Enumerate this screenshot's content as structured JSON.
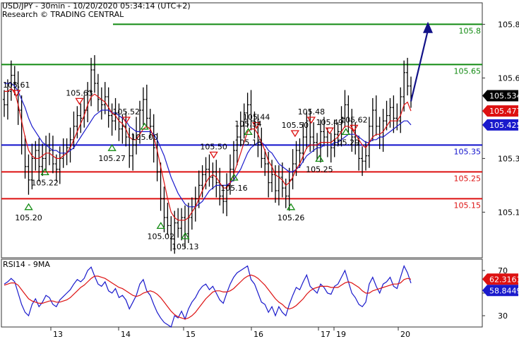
{
  "header": {
    "line1": "USD/JPY - 30min - 10/20/2020 05:34:14 (UTC+2)",
    "line2": "Research © TRADING CENTRAL"
  },
  "colors": {
    "resistance": "#118a11",
    "pivot": "#1010cc",
    "support": "#dd1111",
    "price": "#000000",
    "ma_fast": "#dd1111",
    "ma_slow": "#1a1acc",
    "arrow": "#121288",
    "panel_border": "#333333",
    "last_price_box": "#000000",
    "red_box": "#dd1111",
    "blue_box": "#1a1acc",
    "rsi_fast": "#1a1acc",
    "rsi_slow": "#dd1111"
  },
  "chart_data": [
    {
      "type": "candlestick",
      "title": "USD/JPY - 30min",
      "ylim": [
        104.93,
        105.88
      ],
      "x_labels": [
        "13",
        "14",
        "15",
        "16",
        "17",
        "19",
        "20"
      ],
      "y_ticks": [
        "105.8",
        "105.6",
        "105.3",
        "105.1"
      ],
      "levels": [
        {
          "name": "resistance-2",
          "value": 105.8,
          "label": "105.8",
          "color": "#118a11"
        },
        {
          "name": "resistance-1",
          "value": 105.65,
          "label": "105.65",
          "color": "#118a11"
        },
        {
          "name": "pivot",
          "value": 105.35,
          "label": "105.35",
          "color": "#1010cc"
        },
        {
          "name": "support-1",
          "value": 105.25,
          "label": "105.25",
          "color": "#dd1111"
        },
        {
          "name": "support-2",
          "value": 105.15,
          "label": "105.15",
          "color": "#dd1111"
        }
      ],
      "price_boxes": [
        {
          "name": "last-price",
          "value": 105.534,
          "label": "105.534"
        },
        {
          "name": "ma-fast-value",
          "value": 105.477,
          "label": "105.477"
        },
        {
          "name": "ma-slow-value",
          "value": 105.425,
          "label": "105.425"
        }
      ],
      "swing_highs": [
        {
          "x": 0.03,
          "label": "105.61"
        },
        {
          "x": 0.185,
          "label": "105.63"
        },
        {
          "x": 0.3,
          "label": "105.52"
        },
        {
          "x": 0.515,
          "label": "105.50"
        },
        {
          "x": 0.62,
          "label": "105.44"
        },
        {
          "x": 0.715,
          "label": "105.50"
        },
        {
          "x": 0.755,
          "label": "105.48"
        },
        {
          "x": 0.8,
          "label": "105.49"
        },
        {
          "x": 0.86,
          "label": "105.62"
        }
      ],
      "swing_lows": [
        {
          "x": 0.06,
          "label": "105.20"
        },
        {
          "x": 0.1,
          "label": "105.22"
        },
        {
          "x": 0.265,
          "label": "105.27"
        },
        {
          "x": 0.345,
          "label": "105.00"
        },
        {
          "x": 0.385,
          "label": "105.02"
        },
        {
          "x": 0.445,
          "label": "105.13"
        },
        {
          "x": 0.565,
          "label": "105.16"
        },
        {
          "x": 0.6,
          "label": "105.16"
        },
        {
          "x": 0.705,
          "label": "105.26"
        },
        {
          "x": 0.775,
          "label": "105.25"
        },
        {
          "x": 0.84,
          "label": "105.29"
        }
      ],
      "inline_labels": [
        {
          "x": 0.565,
          "label": "105.34"
        }
      ],
      "projected_target": 105.82,
      "close": [
        105.5,
        105.55,
        105.61,
        105.58,
        105.48,
        105.35,
        105.27,
        105.22,
        105.3,
        105.33,
        105.27,
        105.3,
        105.35,
        105.33,
        105.28,
        105.26,
        105.3,
        105.32,
        105.34,
        105.37,
        105.42,
        105.46,
        105.45,
        105.48,
        105.55,
        105.63,
        105.58,
        105.52,
        105.5,
        105.53,
        105.46,
        105.44,
        105.47,
        105.41,
        105.42,
        105.38,
        105.31,
        105.35,
        105.4,
        105.48,
        105.52,
        105.45,
        105.42,
        105.34,
        105.25,
        105.15,
        105.08,
        105.05,
        105.0,
        105.06,
        105.04,
        105.08,
        105.02,
        105.08,
        105.12,
        105.15,
        105.2,
        105.24,
        105.26,
        105.23,
        105.25,
        105.21,
        105.16,
        105.14,
        105.2,
        105.26,
        105.33,
        105.38,
        105.42,
        105.47,
        105.5,
        105.44,
        105.42,
        105.36,
        105.3,
        105.28,
        105.21,
        105.24,
        105.18,
        105.23,
        105.19,
        105.16,
        105.22,
        105.28,
        105.33,
        105.32,
        105.38,
        105.44,
        105.38,
        105.36,
        105.34,
        105.4,
        105.38,
        105.35,
        105.34,
        105.39,
        105.4,
        105.45,
        105.5,
        105.44,
        105.38,
        105.35,
        105.3,
        105.29,
        105.31,
        105.42,
        105.48,
        105.42,
        105.38,
        105.44,
        105.46,
        105.49,
        105.45,
        105.44,
        105.53,
        105.62,
        105.57,
        105.534
      ],
      "ma_fast": [
        105.55,
        105.55,
        105.56,
        105.55,
        105.5,
        105.44,
        105.38,
        105.33,
        105.31,
        105.3,
        105.3,
        105.31,
        105.32,
        105.32,
        105.31,
        105.3,
        105.3,
        105.31,
        105.32,
        105.34,
        105.37,
        105.4,
        105.43,
        105.46,
        105.5,
        105.53,
        105.54,
        105.53,
        105.52,
        105.51,
        105.49,
        105.47,
        105.46,
        105.44,
        105.43,
        105.41,
        105.38,
        105.37,
        105.37,
        105.39,
        105.41,
        105.42,
        105.41,
        105.38,
        105.33,
        105.27,
        105.21,
        105.15,
        105.1,
        105.08,
        105.07,
        105.07,
        105.07,
        105.08,
        105.1,
        105.12,
        105.15,
        105.18,
        105.21,
        105.23,
        105.24,
        105.23,
        105.21,
        105.19,
        105.19,
        105.21,
        105.24,
        105.28,
        105.32,
        105.36,
        105.4,
        105.41,
        105.41,
        105.39,
        105.36,
        105.33,
        105.29,
        105.27,
        105.24,
        105.23,
        105.22,
        105.2,
        105.21,
        105.23,
        105.26,
        105.28,
        105.31,
        105.34,
        105.35,
        105.35,
        105.35,
        105.36,
        105.36,
        105.36,
        105.36,
        105.37,
        105.38,
        105.4,
        105.42,
        105.42,
        105.41,
        105.39,
        105.37,
        105.35,
        105.34,
        105.36,
        105.38,
        105.39,
        105.39,
        105.4,
        105.42,
        105.44,
        105.44,
        105.44,
        105.46,
        105.5,
        105.51,
        105.477
      ],
      "ma_slow": [
        105.58,
        105.58,
        105.58,
        105.57,
        105.55,
        105.52,
        105.49,
        105.45,
        105.42,
        105.4,
        105.38,
        105.36,
        105.35,
        105.34,
        105.33,
        105.33,
        105.32,
        105.32,
        105.32,
        105.33,
        105.34,
        105.36,
        105.38,
        105.4,
        105.42,
        105.44,
        105.46,
        105.47,
        105.48,
        105.48,
        105.48,
        105.47,
        105.47,
        105.46,
        105.45,
        105.44,
        105.42,
        105.41,
        105.4,
        105.4,
        105.4,
        105.4,
        105.4,
        105.39,
        105.37,
        105.34,
        105.31,
        105.27,
        105.23,
        105.2,
        105.17,
        105.15,
        105.13,
        105.12,
        105.12,
        105.12,
        105.13,
        105.14,
        105.16,
        105.18,
        105.19,
        105.2,
        105.2,
        105.2,
        105.2,
        105.21,
        105.22,
        105.24,
        105.26,
        105.29,
        105.32,
        105.34,
        105.35,
        105.36,
        105.36,
        105.35,
        105.33,
        105.32,
        105.3,
        105.28,
        105.27,
        105.26,
        105.25,
        105.25,
        105.26,
        105.27,
        105.29,
        105.31,
        105.32,
        105.33,
        105.34,
        105.34,
        105.35,
        105.35,
        105.35,
        105.36,
        105.36,
        105.37,
        105.38,
        105.39,
        105.39,
        105.39,
        105.38,
        105.37,
        105.36,
        105.36,
        105.37,
        105.37,
        105.38,
        105.38,
        105.39,
        105.4,
        105.41,
        105.42,
        105.43,
        105.44,
        105.44,
        105.425
      ]
    },
    {
      "type": "line",
      "title": "RSI14 - 9MA",
      "ylim": [
        20,
        80
      ],
      "y_ticks": [
        "70",
        "50",
        "30"
      ],
      "series": [
        {
          "name": "RSI14",
          "value_label": "58.8449"
        },
        {
          "name": "9MA",
          "value_label": "62.3161"
        }
      ],
      "rsi": [
        58,
        60,
        63,
        60,
        50,
        40,
        33,
        30,
        40,
        45,
        38,
        42,
        48,
        46,
        40,
        38,
        44,
        47,
        50,
        53,
        58,
        62,
        60,
        63,
        70,
        73,
        65,
        58,
        56,
        60,
        52,
        50,
        54,
        46,
        48,
        44,
        36,
        42,
        48,
        58,
        62,
        52,
        48,
        40,
        33,
        28,
        24,
        22,
        20,
        30,
        28,
        34,
        27,
        36,
        42,
        46,
        52,
        56,
        58,
        53,
        56,
        50,
        44,
        41,
        50,
        58,
        64,
        68,
        70,
        72,
        74,
        62,
        58,
        50,
        42,
        40,
        33,
        38,
        30,
        38,
        33,
        30,
        40,
        48,
        55,
        53,
        60,
        66,
        56,
        53,
        50,
        58,
        55,
        50,
        49,
        56,
        58,
        64,
        70,
        60,
        50,
        46,
        40,
        38,
        42,
        58,
        64,
        56,
        50,
        58,
        60,
        64,
        56,
        54,
        64,
        74,
        68,
        58.84
      ],
      "ma9": [
        57,
        58,
        59,
        59,
        57,
        53,
        49,
        45,
        43,
        42,
        41,
        41,
        42,
        43,
        43,
        42,
        42,
        43,
        44,
        46,
        49,
        52,
        55,
        57,
        60,
        63,
        65,
        65,
        64,
        63,
        61,
        59,
        57,
        55,
        54,
        52,
        50,
        48,
        47,
        48,
        50,
        51,
        52,
        51,
        49,
        46,
        42,
        38,
        34,
        31,
        29,
        28,
        27,
        28,
        30,
        33,
        37,
        41,
        45,
        48,
        51,
        52,
        52,
        51,
        51,
        52,
        54,
        57,
        60,
        63,
        65,
        66,
        65,
        63,
        60,
        57,
        53,
        49,
        45,
        42,
        40,
        37,
        36,
        37,
        39,
        42,
        45,
        49,
        52,
        54,
        55,
        56,
        56,
        56,
        55,
        55,
        55,
        57,
        59,
        60,
        59,
        57,
        55,
        52,
        50,
        50,
        52,
        53,
        54,
        55,
        56,
        57,
        58,
        58,
        59,
        62,
        63,
        62.32
      ],
      "x_labels": [
        "13",
        "14",
        "15",
        "16",
        "17",
        "19",
        "20"
      ]
    }
  ]
}
